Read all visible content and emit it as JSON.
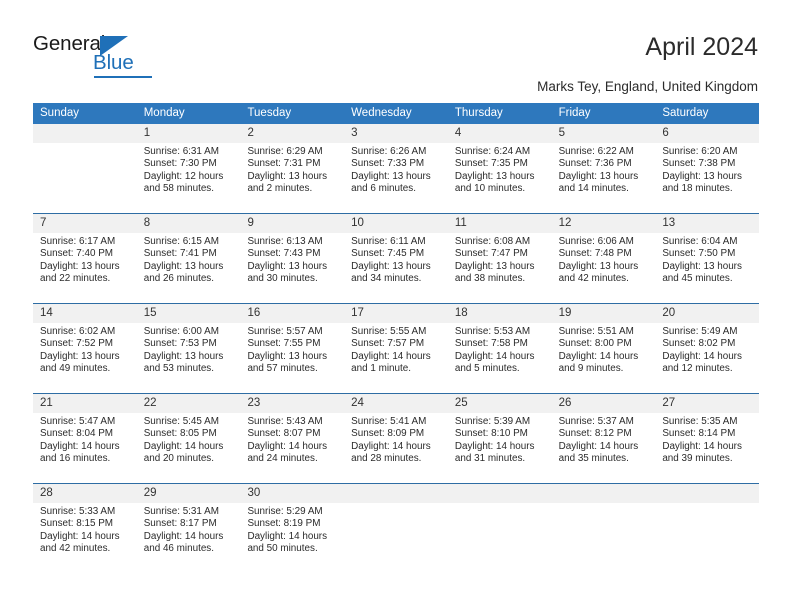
{
  "brand": {
    "name_part1": "General",
    "name_part2": "Blue",
    "triangle_icon": "blue-triangle-icon",
    "accent_color": "#1f70b8"
  },
  "header": {
    "title": "April 2024",
    "subtitle": "Marks Tey, England, United Kingdom"
  },
  "colors": {
    "header_bar": "#2e78bd",
    "row_divider": "#2e6da4",
    "daynum_band": "#f1f1f1",
    "text": "#2b2b2b"
  },
  "weekdays": [
    "Sunday",
    "Monday",
    "Tuesday",
    "Wednesday",
    "Thursday",
    "Friday",
    "Saturday"
  ],
  "weeks": [
    [
      {
        "day": "",
        "sunrise": "",
        "sunset": "",
        "daylight1": "",
        "daylight2": ""
      },
      {
        "day": "1",
        "sunrise": "Sunrise: 6:31 AM",
        "sunset": "Sunset: 7:30 PM",
        "daylight1": "Daylight: 12 hours",
        "daylight2": "and 58 minutes."
      },
      {
        "day": "2",
        "sunrise": "Sunrise: 6:29 AM",
        "sunset": "Sunset: 7:31 PM",
        "daylight1": "Daylight: 13 hours",
        "daylight2": "and 2 minutes."
      },
      {
        "day": "3",
        "sunrise": "Sunrise: 6:26 AM",
        "sunset": "Sunset: 7:33 PM",
        "daylight1": "Daylight: 13 hours",
        "daylight2": "and 6 minutes."
      },
      {
        "day": "4",
        "sunrise": "Sunrise: 6:24 AM",
        "sunset": "Sunset: 7:35 PM",
        "daylight1": "Daylight: 13 hours",
        "daylight2": "and 10 minutes."
      },
      {
        "day": "5",
        "sunrise": "Sunrise: 6:22 AM",
        "sunset": "Sunset: 7:36 PM",
        "daylight1": "Daylight: 13 hours",
        "daylight2": "and 14 minutes."
      },
      {
        "day": "6",
        "sunrise": "Sunrise: 6:20 AM",
        "sunset": "Sunset: 7:38 PM",
        "daylight1": "Daylight: 13 hours",
        "daylight2": "and 18 minutes."
      }
    ],
    [
      {
        "day": "7",
        "sunrise": "Sunrise: 6:17 AM",
        "sunset": "Sunset: 7:40 PM",
        "daylight1": "Daylight: 13 hours",
        "daylight2": "and 22 minutes."
      },
      {
        "day": "8",
        "sunrise": "Sunrise: 6:15 AM",
        "sunset": "Sunset: 7:41 PM",
        "daylight1": "Daylight: 13 hours",
        "daylight2": "and 26 minutes."
      },
      {
        "day": "9",
        "sunrise": "Sunrise: 6:13 AM",
        "sunset": "Sunset: 7:43 PM",
        "daylight1": "Daylight: 13 hours",
        "daylight2": "and 30 minutes."
      },
      {
        "day": "10",
        "sunrise": "Sunrise: 6:11 AM",
        "sunset": "Sunset: 7:45 PM",
        "daylight1": "Daylight: 13 hours",
        "daylight2": "and 34 minutes."
      },
      {
        "day": "11",
        "sunrise": "Sunrise: 6:08 AM",
        "sunset": "Sunset: 7:47 PM",
        "daylight1": "Daylight: 13 hours",
        "daylight2": "and 38 minutes."
      },
      {
        "day": "12",
        "sunrise": "Sunrise: 6:06 AM",
        "sunset": "Sunset: 7:48 PM",
        "daylight1": "Daylight: 13 hours",
        "daylight2": "and 42 minutes."
      },
      {
        "day": "13",
        "sunrise": "Sunrise: 6:04 AM",
        "sunset": "Sunset: 7:50 PM",
        "daylight1": "Daylight: 13 hours",
        "daylight2": "and 45 minutes."
      }
    ],
    [
      {
        "day": "14",
        "sunrise": "Sunrise: 6:02 AM",
        "sunset": "Sunset: 7:52 PM",
        "daylight1": "Daylight: 13 hours",
        "daylight2": "and 49 minutes."
      },
      {
        "day": "15",
        "sunrise": "Sunrise: 6:00 AM",
        "sunset": "Sunset: 7:53 PM",
        "daylight1": "Daylight: 13 hours",
        "daylight2": "and 53 minutes."
      },
      {
        "day": "16",
        "sunrise": "Sunrise: 5:57 AM",
        "sunset": "Sunset: 7:55 PM",
        "daylight1": "Daylight: 13 hours",
        "daylight2": "and 57 minutes."
      },
      {
        "day": "17",
        "sunrise": "Sunrise: 5:55 AM",
        "sunset": "Sunset: 7:57 PM",
        "daylight1": "Daylight: 14 hours",
        "daylight2": "and 1 minute."
      },
      {
        "day": "18",
        "sunrise": "Sunrise: 5:53 AM",
        "sunset": "Sunset: 7:58 PM",
        "daylight1": "Daylight: 14 hours",
        "daylight2": "and 5 minutes."
      },
      {
        "day": "19",
        "sunrise": "Sunrise: 5:51 AM",
        "sunset": "Sunset: 8:00 PM",
        "daylight1": "Daylight: 14 hours",
        "daylight2": "and 9 minutes."
      },
      {
        "day": "20",
        "sunrise": "Sunrise: 5:49 AM",
        "sunset": "Sunset: 8:02 PM",
        "daylight1": "Daylight: 14 hours",
        "daylight2": "and 12 minutes."
      }
    ],
    [
      {
        "day": "21",
        "sunrise": "Sunrise: 5:47 AM",
        "sunset": "Sunset: 8:04 PM",
        "daylight1": "Daylight: 14 hours",
        "daylight2": "and 16 minutes."
      },
      {
        "day": "22",
        "sunrise": "Sunrise: 5:45 AM",
        "sunset": "Sunset: 8:05 PM",
        "daylight1": "Daylight: 14 hours",
        "daylight2": "and 20 minutes."
      },
      {
        "day": "23",
        "sunrise": "Sunrise: 5:43 AM",
        "sunset": "Sunset: 8:07 PM",
        "daylight1": "Daylight: 14 hours",
        "daylight2": "and 24 minutes."
      },
      {
        "day": "24",
        "sunrise": "Sunrise: 5:41 AM",
        "sunset": "Sunset: 8:09 PM",
        "daylight1": "Daylight: 14 hours",
        "daylight2": "and 28 minutes."
      },
      {
        "day": "25",
        "sunrise": "Sunrise: 5:39 AM",
        "sunset": "Sunset: 8:10 PM",
        "daylight1": "Daylight: 14 hours",
        "daylight2": "and 31 minutes."
      },
      {
        "day": "26",
        "sunrise": "Sunrise: 5:37 AM",
        "sunset": "Sunset: 8:12 PM",
        "daylight1": "Daylight: 14 hours",
        "daylight2": "and 35 minutes."
      },
      {
        "day": "27",
        "sunrise": "Sunrise: 5:35 AM",
        "sunset": "Sunset: 8:14 PM",
        "daylight1": "Daylight: 14 hours",
        "daylight2": "and 39 minutes."
      }
    ],
    [
      {
        "day": "28",
        "sunrise": "Sunrise: 5:33 AM",
        "sunset": "Sunset: 8:15 PM",
        "daylight1": "Daylight: 14 hours",
        "daylight2": "and 42 minutes."
      },
      {
        "day": "29",
        "sunrise": "Sunrise: 5:31 AM",
        "sunset": "Sunset: 8:17 PM",
        "daylight1": "Daylight: 14 hours",
        "daylight2": "and 46 minutes."
      },
      {
        "day": "30",
        "sunrise": "Sunrise: 5:29 AM",
        "sunset": "Sunset: 8:19 PM",
        "daylight1": "Daylight: 14 hours",
        "daylight2": "and 50 minutes."
      },
      {
        "day": "",
        "sunrise": "",
        "sunset": "",
        "daylight1": "",
        "daylight2": ""
      },
      {
        "day": "",
        "sunrise": "",
        "sunset": "",
        "daylight1": "",
        "daylight2": ""
      },
      {
        "day": "",
        "sunrise": "",
        "sunset": "",
        "daylight1": "",
        "daylight2": ""
      },
      {
        "day": "",
        "sunrise": "",
        "sunset": "",
        "daylight1": "",
        "daylight2": ""
      }
    ]
  ]
}
